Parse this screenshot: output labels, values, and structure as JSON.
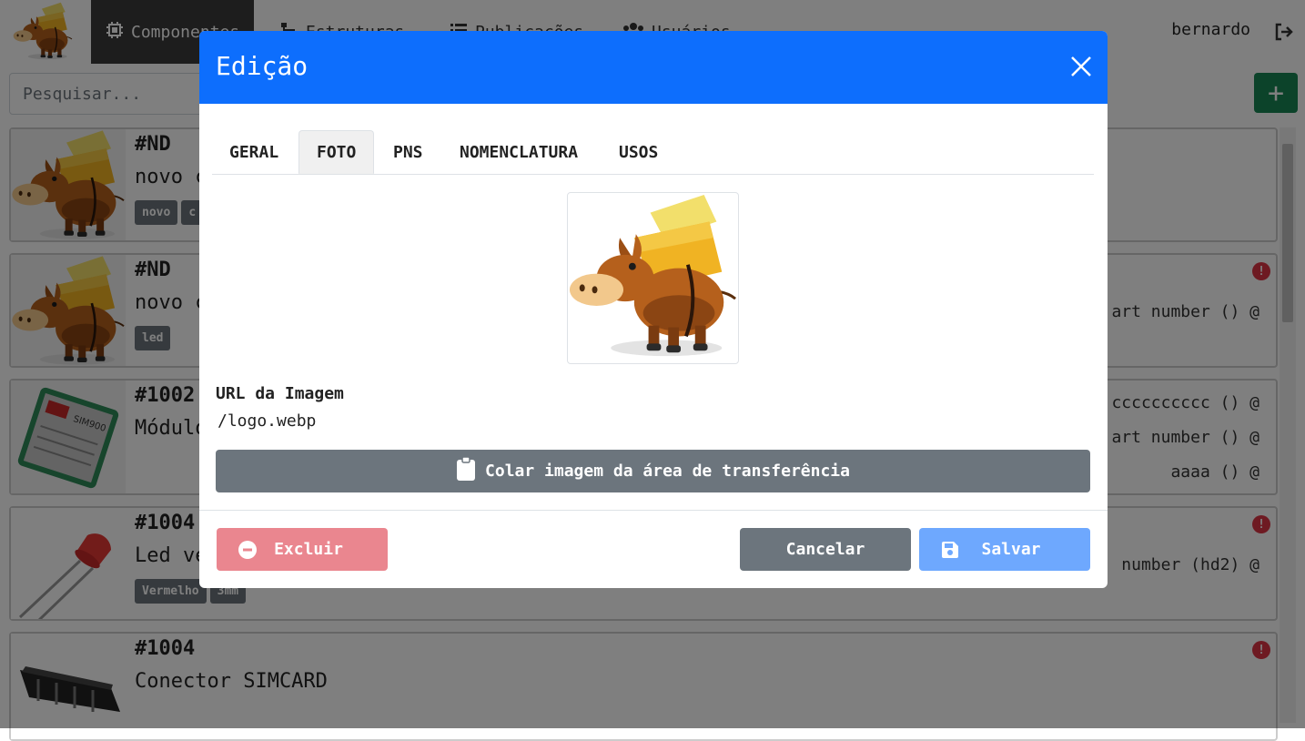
{
  "navbar": {
    "items": [
      {
        "label": "Componentes",
        "icon": "chip-icon",
        "active": true
      },
      {
        "label": "Estruturas",
        "icon": "sitemap-icon"
      },
      {
        "label": "Publicações",
        "icon": "list-icon"
      },
      {
        "label": "Usuários",
        "icon": "users-icon"
      }
    ],
    "user": "bernardo"
  },
  "search": {
    "placeholder": "Pesquisar..."
  },
  "add_label": "+",
  "cards": [
    {
      "code": "#ND",
      "name": "novo c",
      "badges": [
        "novo",
        "c"
      ]
    },
    {
      "code": "#ND",
      "name": "novo c",
      "badges": [
        "led"
      ],
      "right": [
        "art number () @"
      ],
      "alert": "!"
    },
    {
      "code": "#1002",
      "name": "Módulo",
      "right": [
        "cccccccccc () @",
        "art number () @",
        "aaaa () @"
      ]
    },
    {
      "code": "#1004",
      "name": "Led ve",
      "badges": [
        "Vermelho",
        "3mm"
      ],
      "right": [
        "number (hd2) @"
      ],
      "alert": "!"
    },
    {
      "code": "#1004",
      "name": "Conector SIMCARD",
      "alert": "!"
    }
  ],
  "modal": {
    "title": "Edição",
    "tabs": [
      "GERAL",
      "FOTO",
      "PNS",
      "NOMENCLATURA",
      "USOS"
    ],
    "active_tab": "FOTO",
    "url_label": "URL da Imagem",
    "url_value": "/logo.webp",
    "paste_label": "Colar imagem da área de transferência",
    "delete_label": "Excluir",
    "cancel_label": "Cancelar",
    "save_label": "Salvar"
  },
  "colors": {
    "primary": "#0d6efd",
    "secondary": "#6c757d",
    "danger_light": "#ea868f",
    "primary_light": "#6ea8fe",
    "success": "#198754"
  }
}
